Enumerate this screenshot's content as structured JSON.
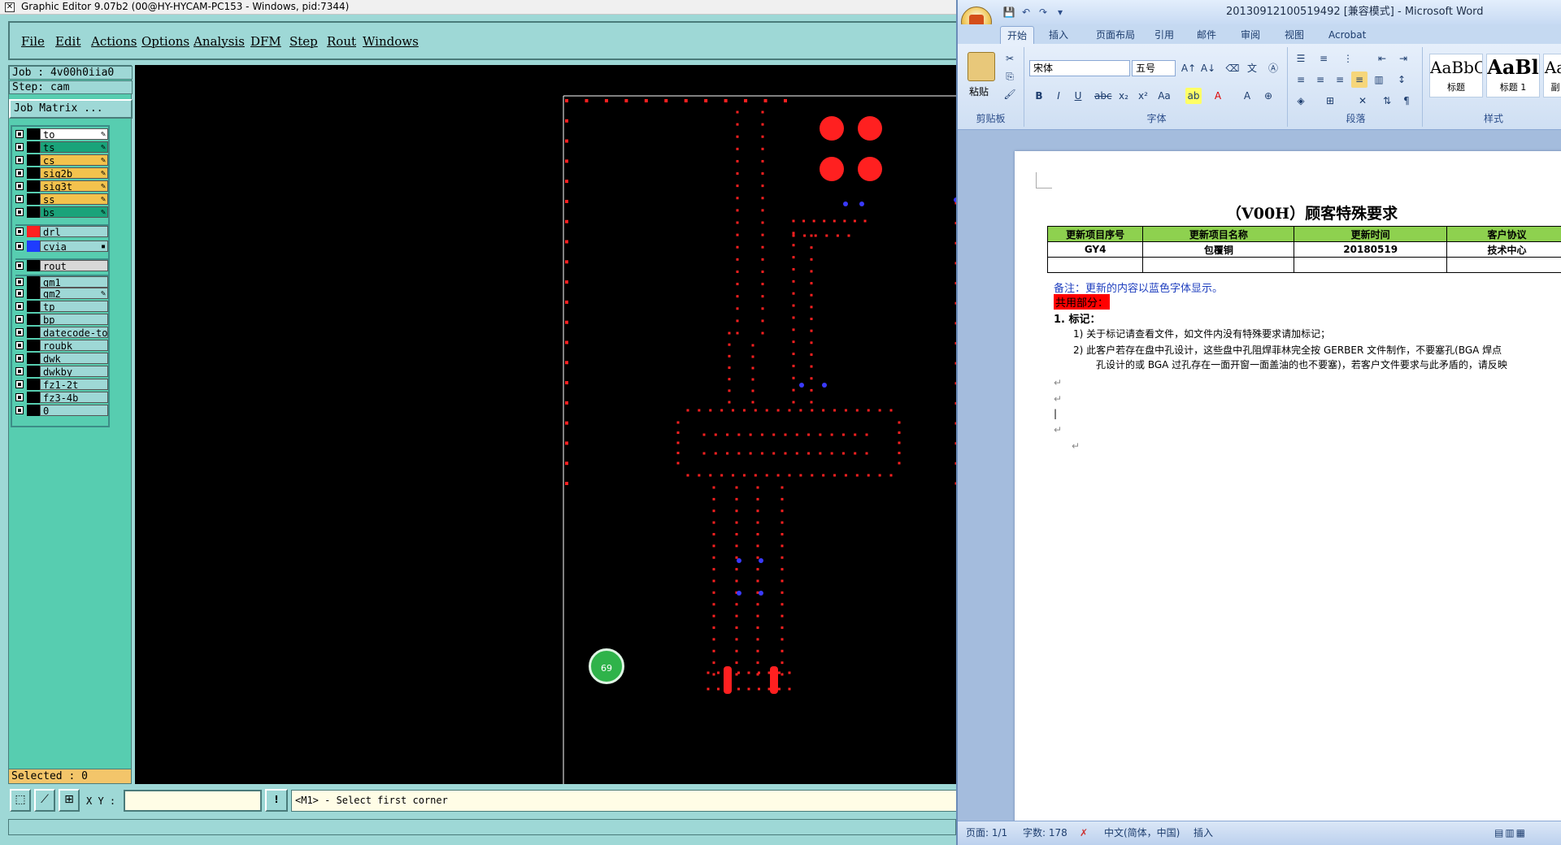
{
  "graphic_editor": {
    "title": "Graphic Editor 9.07b2 (00@HY-HYCAM-PC153 - Windows, pid:7344)",
    "menu": [
      "File",
      "Edit",
      "Actions",
      "Options",
      "Analysis",
      "DFM",
      "Step",
      "Rout",
      "Windows"
    ],
    "job": "Job : 4v00h0iia0",
    "step": "Step: cam",
    "job_matrix_label": "Job Matrix ...",
    "layers": [
      {
        "name": "to",
        "color": "#ffffff",
        "flag": "✎"
      },
      {
        "name": "ts",
        "color": "#1aa37a",
        "flag": "✎"
      },
      {
        "name": "cs",
        "color": "#f3c24d",
        "flag": "✎"
      },
      {
        "name": "sig2b",
        "color": "#f3c24d",
        "flag": "✎"
      },
      {
        "name": "sig3t",
        "color": "#f3c24d",
        "flag": "✎"
      },
      {
        "name": "ss",
        "color": "#f3c24d",
        "flag": "✎"
      },
      {
        "name": "bs",
        "color": "#1aa37a",
        "flag": "✎"
      },
      {
        "name": "drl",
        "color": "#9ed8d6",
        "swatch": "#ff2020",
        "flag": ""
      },
      {
        "name": "cvia",
        "color": "#9ed8d6",
        "swatch": "#1e3cff",
        "flag": "▪"
      },
      {
        "name": "rout",
        "color": "#d8d8d8",
        "flag": ""
      },
      {
        "name": "gm1",
        "color": "#9ed8d6",
        "flag": ""
      },
      {
        "name": "gm2",
        "color": "#9ed8d6",
        "flag": "✎"
      },
      {
        "name": "tp",
        "color": "#9ed8d6",
        "flag": ""
      },
      {
        "name": "bp",
        "color": "#9ed8d6",
        "flag": ""
      },
      {
        "name": "datecode-to",
        "color": "#9ed8d6",
        "flag": ""
      },
      {
        "name": "roubk",
        "color": "#9ed8d6",
        "flag": ""
      },
      {
        "name": "dwk",
        "color": "#9ed8d6",
        "flag": ""
      },
      {
        "name": "dwkby",
        "color": "#9ed8d6",
        "flag": ""
      },
      {
        "name": "fz1-2t",
        "color": "#9ed8d6",
        "flag": ""
      },
      {
        "name": "fz3-4b",
        "color": "#9ed8d6",
        "flag": ""
      },
      {
        "name": "0",
        "color": "#9ed8d6",
        "flag": ""
      }
    ],
    "selected": "Selected : 0",
    "xy_label": "X Y :",
    "xy_value": "",
    "xy_button": "!",
    "prompt": "<M1> - Select first corner"
  },
  "word": {
    "title": "20130912100519492 [兼容模式] - Microsoft Word",
    "tabs": [
      "开始",
      "插入",
      "页面布局",
      "引用",
      "邮件",
      "审阅",
      "视图",
      "Acrobat"
    ],
    "ribbon": {
      "paste_label": "粘贴",
      "clipboard_label": "剪贴板",
      "font_name": "宋体",
      "font_size": "五号",
      "font_label": "字体",
      "paragraph_label": "段落",
      "styles_label": "样式",
      "style_1_preview": "AaBbC",
      "style_1_name": "标题",
      "style_2_preview": "AaBl",
      "style_2_name": "标题 1",
      "style_3_preview": "Aa",
      "style_3_name": "副"
    },
    "doc": {
      "title": "（V00H）顾客特殊要求",
      "table_headers": [
        "更新项目序号",
        "更新项目名称",
        "更新时间",
        "客户协议"
      ],
      "table_row": [
        "GY4",
        "包覆铜",
        "20180519",
        "技术中心"
      ],
      "note_prefix": "备注：",
      "note_text": "更新的内容以蓝色字体显示。",
      "shared_part": "共用部分：",
      "item1": "1.   标记：",
      "item1_1": "1)   关于标记请查看文件，如文件内没有特殊要求请加标记；",
      "item1_2": "2)   此客户若存在盘中孔设计，这些盘中孔阻焊菲林完全按 GERBER 文件制作，不要塞孔(BGA 焊点",
      "item1_2b": "孔设计的或 BGA 过孔存在一面开窗一面盖油的也不要塞)，若客户文件要求与此矛盾的，请反映"
    },
    "status": {
      "page": "页面: 1/1",
      "words": "字数: 178",
      "lang": "中文(简体，中国)",
      "mode": "插入"
    },
    "badge": "69"
  }
}
